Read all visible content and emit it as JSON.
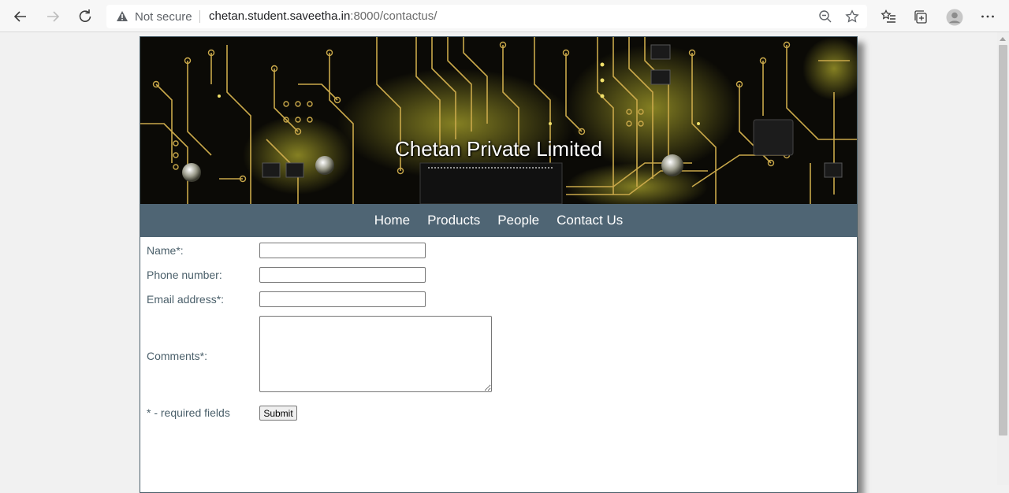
{
  "browser": {
    "security_text": "Not secure",
    "url_host": "chetan.student.saveetha.in",
    "url_path": ":8000/contactus/",
    "icons": [
      "back-icon",
      "forward-icon",
      "refresh-icon",
      "warning-icon",
      "zoom-icon",
      "favorite-star-icon",
      "favorites-list-icon",
      "collections-icon",
      "profile-icon",
      "more-icon"
    ]
  },
  "site": {
    "title": "Chetan Private Limited",
    "nav": [
      "Home",
      "Products",
      "People",
      "Contact Us"
    ]
  },
  "form": {
    "name_label": "Name*:",
    "phone_label": "Phone number:",
    "email_label": "Email address*:",
    "comments_label": "Comments*:",
    "required_note": "* - required fields",
    "submit_label": "Submit",
    "name_value": "",
    "phone_value": "",
    "email_value": "",
    "comments_value": ""
  },
  "colors": {
    "nav_bg": "#4f6574",
    "label_text": "#4a5f6a",
    "circuit_trace": "#c9a84a",
    "circuit_glow": "#e8e03a"
  }
}
